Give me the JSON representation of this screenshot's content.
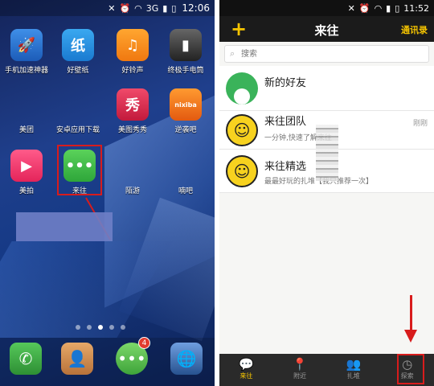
{
  "left_phone": {
    "status": {
      "signal": "3G",
      "time": "12:06"
    },
    "apps": [
      {
        "label": "手机加速神器",
        "glyph": "🚀",
        "icon": "rocket-icon"
      },
      {
        "label": "好壁纸",
        "glyph": "纸",
        "icon": "wallpaper-icon"
      },
      {
        "label": "好铃声",
        "glyph": "♫",
        "icon": "music-note-icon"
      },
      {
        "label": "终极手电筒",
        "glyph": "▮",
        "icon": "flashlight-icon"
      },
      {
        "label": "美团",
        "glyph": "",
        "icon": "meituan-icon"
      },
      {
        "label": "安卓应用下载",
        "glyph": "",
        "icon": "store-icon"
      },
      {
        "label": "美图秀秀",
        "glyph": "秀",
        "icon": "xiuxiu-icon"
      },
      {
        "label": "逆袭吧",
        "glyph": "nixiba",
        "icon": "nixiba-icon"
      },
      {
        "label": "美拍",
        "glyph": "▶",
        "icon": "camera-icon"
      },
      {
        "label": "来往",
        "glyph": "•••",
        "icon": "chat-bubble-icon"
      },
      {
        "label": "陌游",
        "glyph": "",
        "icon": "hidden-app-icon"
      },
      {
        "label": "喃吧",
        "glyph": "",
        "icon": "hidden-app-icon"
      }
    ],
    "page_dots": 5,
    "active_dot": 2,
    "dock": [
      {
        "name": "phone",
        "glyph": "✆",
        "icon": "phone-icon"
      },
      {
        "name": "contacts",
        "glyph": "👤",
        "icon": "contacts-icon"
      },
      {
        "name": "messages",
        "glyph": "•••",
        "icon": "message-icon"
      },
      {
        "name": "browser",
        "glyph": "🌐",
        "icon": "globe-icon"
      }
    ],
    "messages_badge": "4"
  },
  "right_phone": {
    "status": {
      "time": "11:52"
    },
    "header": {
      "add": "+",
      "title": "来往",
      "contacts": "通讯录"
    },
    "search": {
      "placeholder": "搜索"
    },
    "rows": [
      {
        "name": "新的好友",
        "sub": "",
        "time": ""
      },
      {
        "name": "来往团队",
        "sub": "一分钟,快速了解来往",
        "time": "刚刚"
      },
      {
        "name": "来往精选",
        "sub": "最最好玩的扎堆【我只推荐一次】",
        "time": ""
      }
    ],
    "tabs": [
      {
        "label": "来往",
        "glyph": "💬",
        "icon": "chat-tab-icon"
      },
      {
        "label": "附近",
        "glyph": "📍",
        "icon": "location-pin-icon"
      },
      {
        "label": "扎堆",
        "glyph": "👥",
        "icon": "group-icon"
      },
      {
        "label": "探索",
        "glyph": "◷",
        "icon": "compass-icon"
      }
    ]
  },
  "colors": {
    "accent": "#f5c400",
    "highlight": "#d81c1c"
  }
}
